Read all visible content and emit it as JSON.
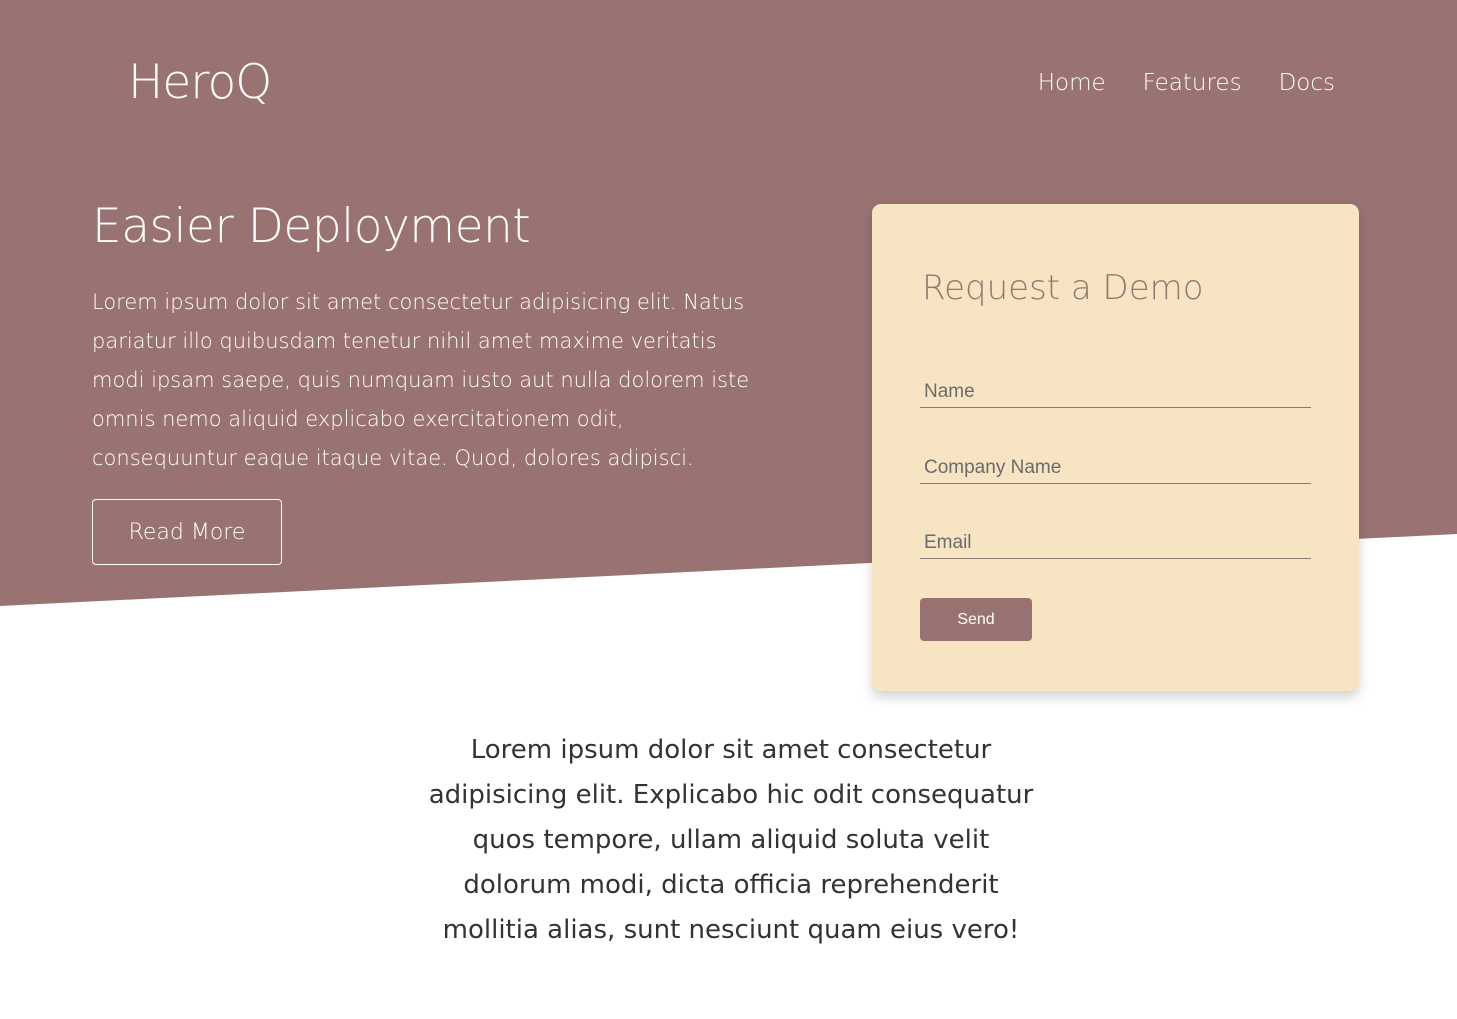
{
  "header": {
    "logo": "HeroQ",
    "nav": [
      {
        "label": "Home"
      },
      {
        "label": "Features"
      },
      {
        "label": "Docs"
      }
    ]
  },
  "hero": {
    "title": "Easier Deployment",
    "text": "Lorem ipsum dolor sit amet consectetur adipisicing elit. Natus pariatur illo quibusdam tenetur nihil amet maxime veritatis modi ipsam saepe, quis numquam iusto aut nulla dolorem iste omnis nemo aliquid explicabo exercitationem odit, consequuntur eaque itaque vitae. Quod, dolores adipisci.",
    "button_label": "Read More"
  },
  "demo_form": {
    "title": "Request a Demo",
    "name_placeholder": "Name",
    "company_placeholder": "Company Name",
    "email_placeholder": "Email",
    "send_label": "Send"
  },
  "lower": {
    "text": "Lorem ipsum dolor sit amet consectetur adipisicing elit. Explicabo hic odit consequatur quos tempore, ullam aliquid soluta velit dolorum modi, dicta officia reprehenderit mollitia alias, sunt nesciunt quam eius vero!"
  },
  "colors": {
    "primary": "#997371",
    "card_background": "#f7e4c3",
    "text_dark": "#333333"
  }
}
